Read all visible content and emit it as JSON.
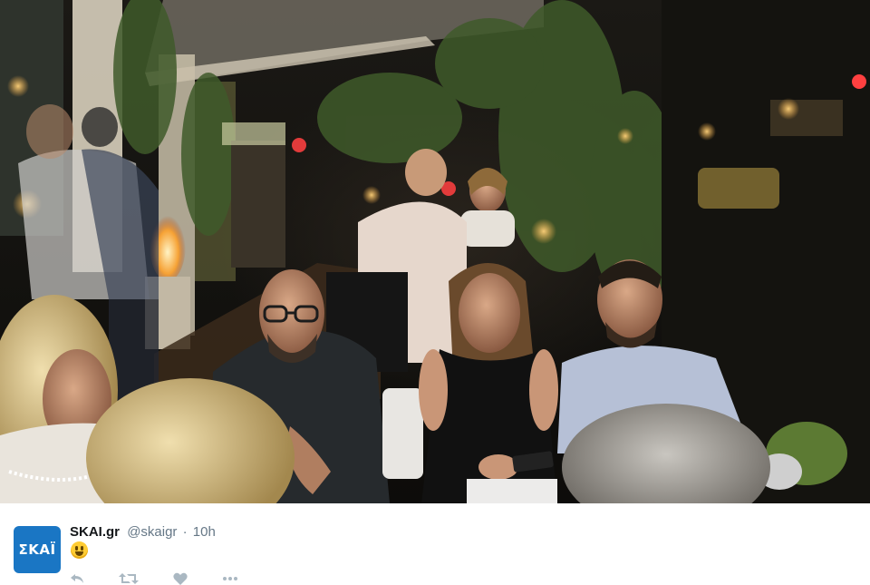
{
  "photo": {
    "description_icon": "restaurant-photo",
    "colors": {
      "shadow": "#13120f",
      "warm_light": "#f4a340",
      "foliage": "#3f5a2a"
    }
  },
  "tweet": {
    "avatar_text": "ΣΚΑΪ",
    "display_name": "SKAI.gr",
    "handle": "@skaigr",
    "separator": "·",
    "time": "10h",
    "emoji": "smiley-face",
    "actions": [
      {
        "name": "reply-icon",
        "count": ""
      },
      {
        "name": "retweet-icon",
        "count": ""
      },
      {
        "name": "like-icon",
        "count": ""
      },
      {
        "name": "more-icon",
        "count": ""
      }
    ],
    "colors": {
      "brand": "#1a76c4",
      "muted": "#657786",
      "text": "#14171a"
    }
  }
}
